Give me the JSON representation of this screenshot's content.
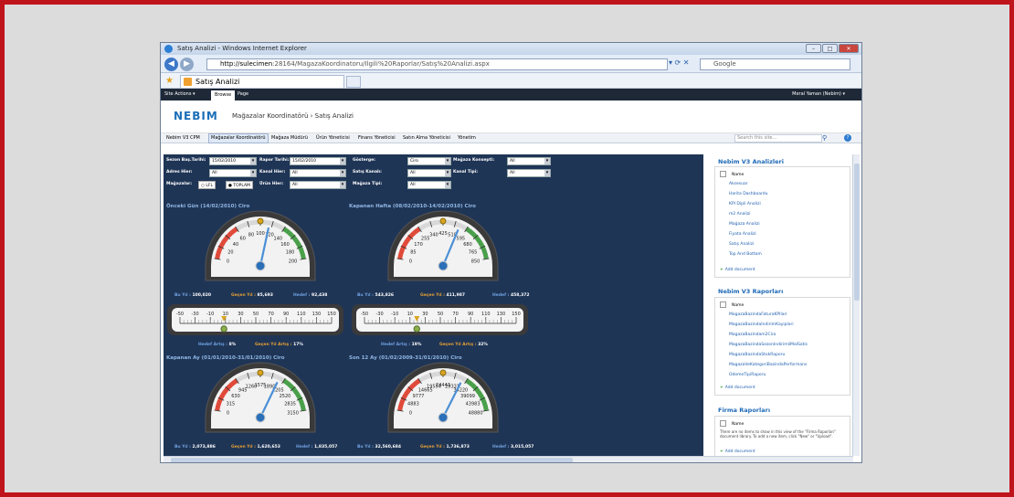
{
  "window": {
    "title": "Satış Analizi - Windows Internet Explorer"
  },
  "browser": {
    "url_host": "http://sulecimen",
    "url_rest": ":28164/MagazaKoordinatoru/Ilgili%20Raporlar/Satış%20Analizi.aspx",
    "search_placeholder": "Google",
    "tab_title": "Satış Analizi"
  },
  "sp": {
    "site_actions": "Site Actions ▾",
    "browse": "Browse",
    "page": "Page",
    "user": "Meral Yaman (Nebim) ▾",
    "logo": "NEBIM",
    "breadcrumb": "Mağazalar Koordinatörü › Satış Analizi",
    "nav": [
      "Nebim V3 CPM",
      "Mağazalar Koordinatörü",
      "Mağaza Müdürü",
      "Ürün Yöneticisi",
      "Finans Yöneticisi",
      "Satın Alma Yöneticisi",
      "Yönetim"
    ],
    "search_placeholder": "Search this site..."
  },
  "filters": {
    "sezon_label": "Sezon Baş.Tarihi:",
    "sezon_value": "15/02/2010",
    "rapor_label": "Rapor Tarihi:",
    "rapor_value": "15/02/2010",
    "gosterge_label": "Gösterge:",
    "gosterge_value": "Ciro",
    "konsept_label": "Mağaza Konsepti:",
    "konsept_value": "All",
    "adres_label": "Adres Hier:",
    "adres_value": "All",
    "kanal_label": "Kanal Hier:",
    "kanal_value": "All",
    "satis_label": "Satış Kanalı:",
    "satis_value": "All",
    "kanaltipi_label": "Kanal Tipi:",
    "kanaltipi_value": "All",
    "magazalar_label": "Mağazalar:",
    "lfl": "LFL",
    "toplam": "TOPLAM",
    "urun_label": "Ürün Hier:",
    "urun_value": "All",
    "tipi_label": "Mağaza Tipi:",
    "tipi_value": "All"
  },
  "gauges": [
    {
      "title": "Önceki Gün (14/02/2010) Ciro",
      "ticks": [
        "0",
        "20",
        "40",
        "60",
        "80",
        "100",
        "120",
        "140",
        "160",
        "180",
        "200"
      ],
      "value": 115,
      "min": 0,
      "max": 200,
      "bu_label": "Bu Yıl :",
      "bu": "100,020",
      "gecen_label": "Geçen Yıl :",
      "gecen": "85,693",
      "hedef_label": "Hedef :",
      "hedef": "92,438"
    },
    {
      "title": "Kapanan Hafta (08/02/2010-14/02/2010) Ciro",
      "ticks": [
        "0",
        "85",
        "170",
        "255",
        "340",
        "425",
        "510",
        "595",
        "680",
        "765",
        "850"
      ],
      "value": 543.8,
      "min": 0,
      "max": 850,
      "bu_label": "Bu Yıl :",
      "bu": "543,826",
      "gecen_label": "Geçen Yıl :",
      "gecen": "411,987",
      "hedef_label": "Hedef :",
      "hedef": "458,372"
    },
    {
      "title": "Kapanan Ay (01/01/2010-31/01/2010) Ciro",
      "ticks": [
        "0",
        "315",
        "630",
        "945",
        "1260",
        "1575",
        "1890",
        "2205",
        "2520",
        "2835",
        "3150"
      ],
      "value": 2073.9,
      "min": 0,
      "max": 3150,
      "bu_label": "Bu Yıl :",
      "bu": "2,073,886",
      "gecen_label": "Geçen Yıl :",
      "gecen": "1,620,653",
      "hedef_label": "Hedef :",
      "hedef": "1,835,057"
    },
    {
      "title": "Son 12 Ay (01/02/2009-31/01/2010) Ciro",
      "ticks": [
        "0",
        "4883",
        "9777",
        "14665",
        "19554",
        "24443",
        "29331",
        "34220",
        "39099",
        "43983",
        "48880"
      ],
      "value": 32560.7,
      "min": 0,
      "max": 48880,
      "bu_label": "Bu Yıl :",
      "bu": "32,560,684",
      "gecen_label": "Geçen Yıl :",
      "gecen": "1,736,873",
      "hedef_label": "Hedef :",
      "hedef": "3,015,057"
    }
  ],
  "linears": [
    {
      "ticks": [
        "-50",
        "-30",
        "-10",
        "10",
        "30",
        "50",
        "70",
        "90",
        "110",
        "130",
        "150"
      ],
      "value": 8,
      "extra_ticks": [
        "-40",
        "-20",
        "0",
        "20",
        "40",
        "60",
        "80",
        "100",
        "120",
        "140"
      ],
      "hedef_label": "Hedef Artış :",
      "hedef": "8%",
      "gecen_label": "Geçen Yıl Artış :",
      "gecen": "17%"
    },
    {
      "ticks": [
        "-50",
        "-30",
        "-10",
        "10",
        "30",
        "50",
        "70",
        "90",
        "110",
        "130",
        "150"
      ],
      "value": 19,
      "extra_ticks": [
        "-40",
        "-20",
        "0",
        "20",
        "40",
        "60",
        "80",
        "100",
        "120",
        "140"
      ],
      "hedef_label": "Hedef Artış :",
      "hedef": "19%",
      "gecen_label": "Geçen Yıl Artış :",
      "gecen": "32%"
    }
  ],
  "side": {
    "analiz_title": "Nebim V3 Analizleri",
    "name_col": "Name",
    "analiz_items": [
      "Aksesuar",
      "Harita Dashboardu",
      "KPI Dipli Analizi",
      "m2 Analizi",
      "Mağaza Analizi",
      "Fiyata Analizi",
      "Satış Analizi",
      "Top And Bottom"
    ],
    "raporlar_title": "Nebim V3 Raporları",
    "raporlar_items": [
      "MagazaBazindaFaturaKPIlari",
      "MagazaBazindaIndirimKayiplari",
      "MagazaBazindam2Ciro",
      "MagazaBazindaSezonIndirimliMalSatis",
      "MagazaBazindaStokRaporu",
      "MagazaVeKategoriBazindaPerformans",
      "OdemeTipiRaporu"
    ],
    "firma_title": "Firma Raporları",
    "firma_empty": "There are no items to show in this view of the \"Firma Raporları\" document library. To add a new item, click \"New\" or \"Upload\".",
    "add_document": "Add document"
  },
  "colors": {
    "dashboard_bg": "#1f3556",
    "accent_link": "#1f5fb0",
    "label_blue": "#6fa1e0",
    "label_orange": "#e4a034"
  }
}
